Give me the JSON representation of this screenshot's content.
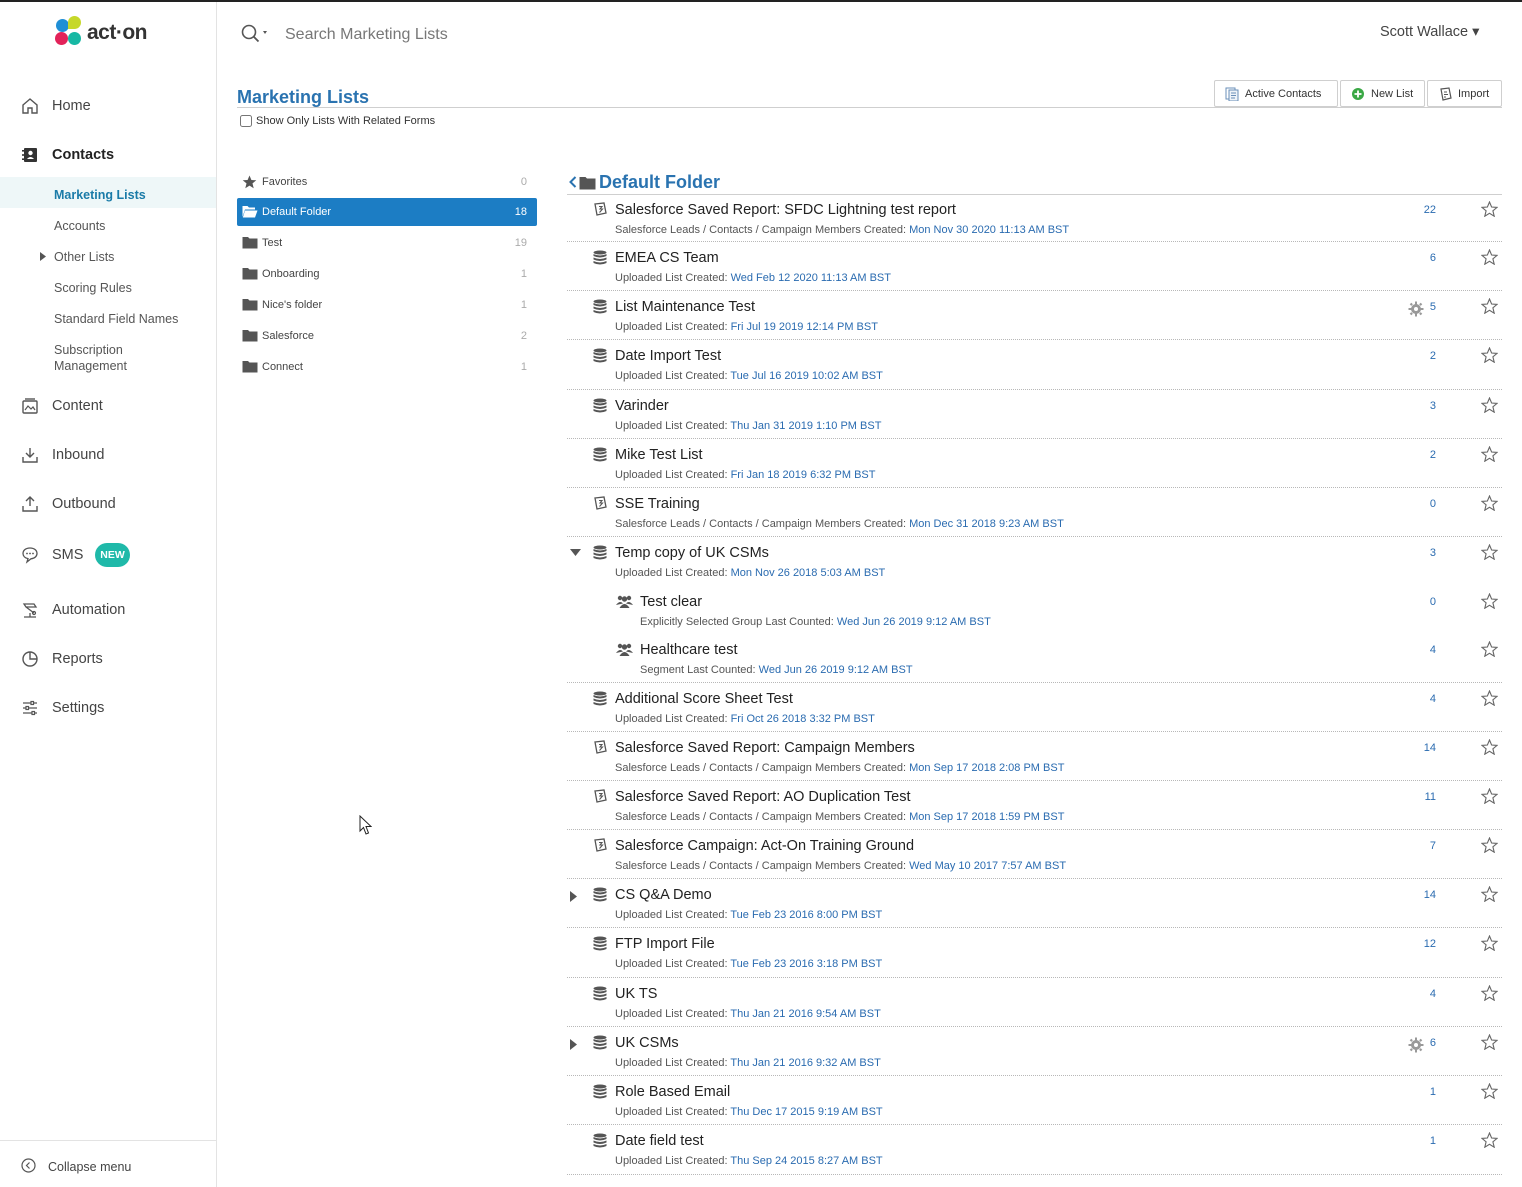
{
  "app": {
    "brand": "act·on",
    "colors": {
      "accent": "#2a73b0",
      "active_folder": "#1c7dc4",
      "badge": "#1fb9a9"
    }
  },
  "search": {
    "placeholder": "Search Marketing Lists"
  },
  "user": {
    "name": "Scott Wallace ▾"
  },
  "nav": {
    "home": "Home",
    "contacts": "Contacts",
    "content": "Content",
    "inbound": "Inbound",
    "outbound": "Outbound",
    "sms": "SMS",
    "sms_badge": "NEW",
    "automation": "Automation",
    "reports": "Reports",
    "settings": "Settings",
    "collapse": "Collapse menu"
  },
  "contacts_sub": {
    "marketing_lists": "Marketing Lists",
    "accounts": "Accounts",
    "other_lists": "Other Lists",
    "scoring_rules": "Scoring Rules",
    "standard_field_names": "Standard Field Names",
    "subscription_line1": "Subscription",
    "subscription_line2": "Management"
  },
  "header": {
    "title": "Marketing Lists",
    "related_forms_label": "Show Only Lists With Related Forms",
    "buttons": {
      "active_contacts": "Active Contacts",
      "new_list": "New List",
      "import": "Import"
    }
  },
  "folders": [
    {
      "label": "Favorites",
      "count": "0",
      "icon": "star-icon"
    },
    {
      "label": "Default Folder",
      "count": "18",
      "icon": "folder-open-icon"
    },
    {
      "label": "Test",
      "count": "19",
      "icon": "folder-icon"
    },
    {
      "label": "Onboarding",
      "count": "1",
      "icon": "folder-icon"
    },
    {
      "label": "Nice's folder",
      "count": "1",
      "icon": "folder-icon"
    },
    {
      "label": "Salesforce",
      "count": "2",
      "icon": "folder-icon"
    },
    {
      "label": "Connect",
      "count": "1",
      "icon": "folder-icon"
    }
  ],
  "current_folder": {
    "title": "Default Folder"
  },
  "lists": [
    {
      "name": "Salesforce Saved Report: SFDC Lightning test report",
      "meta": "Salesforce Leads / Contacts / Campaign Members Created: ",
      "date": "Mon Nov 30 2020 11:13 AM BST",
      "count": "22",
      "icon": "salesforce-icon"
    },
    {
      "name": "EMEA CS Team",
      "meta": "Uploaded List Created: ",
      "date": "Wed Feb 12 2020 11:13 AM BST",
      "count": "6",
      "icon": "database-icon"
    },
    {
      "name": "List Maintenance Test",
      "meta": "Uploaded List Created: ",
      "date": "Fri Jul 19 2019 12:14 PM BST",
      "count": "5",
      "icon": "database-icon"
    },
    {
      "name": "Date Import Test",
      "meta": "Uploaded List Created: ",
      "date": "Tue Jul 16 2019 10:02 AM BST",
      "count": "2",
      "icon": "database-icon"
    },
    {
      "name": "Varinder",
      "meta": "Uploaded List Created: ",
      "date": "Thu Jan 31 2019 1:10 PM BST",
      "count": "3",
      "icon": "database-icon"
    },
    {
      "name": "Mike Test List",
      "meta": "Uploaded List Created: ",
      "date": "Fri Jan 18 2019 6:32 PM BST",
      "count": "2",
      "icon": "database-icon"
    },
    {
      "name": "SSE Training",
      "meta": "Salesforce Leads / Contacts / Campaign Members Created: ",
      "date": "Mon Dec 31 2018 9:23 AM BST",
      "count": "0",
      "icon": "salesforce-icon"
    },
    {
      "name": "Temp copy of UK CSMs",
      "meta": "Uploaded List Created: ",
      "date": "Mon Nov 26 2018 5:03 AM BST",
      "count": "3",
      "icon": "database-icon"
    },
    {
      "name": "Test clear",
      "meta": "Explicitly Selected Group Last Counted: ",
      "date": "Wed Jun 26 2019 9:12 AM BST",
      "count": "0",
      "icon": "group-icon"
    },
    {
      "name": "Healthcare test",
      "meta": "Segment Last Counted: ",
      "date": "Wed Jun 26 2019 9:12 AM BST",
      "count": "4",
      "icon": "group-icon"
    },
    {
      "name": "Additional Score Sheet Test",
      "meta": "Uploaded List Created: ",
      "date": "Fri Oct 26 2018 3:32 PM BST",
      "count": "4",
      "icon": "database-icon"
    },
    {
      "name": "Salesforce Saved Report: Campaign Members",
      "meta": "Salesforce Leads / Contacts / Campaign Members Created: ",
      "date": "Mon Sep 17 2018 2:08 PM BST",
      "count": "14",
      "icon": "salesforce-icon"
    },
    {
      "name": "Salesforce Saved Report: AO Duplication Test",
      "meta": "Salesforce Leads / Contacts / Campaign Members Created: ",
      "date": "Mon Sep 17 2018 1:59 PM BST",
      "count": "11",
      "icon": "salesforce-icon"
    },
    {
      "name": "Salesforce Campaign: Act-On Training Ground",
      "meta": "Salesforce Leads / Contacts / Campaign Members Created: ",
      "date": "Wed May 10 2017 7:57 AM BST",
      "count": "7",
      "icon": "salesforce-icon"
    },
    {
      "name": "CS Q&A Demo",
      "meta": "Uploaded List Created: ",
      "date": "Tue Feb 23 2016 8:00 PM BST",
      "count": "14",
      "icon": "database-icon"
    },
    {
      "name": "FTP Import File",
      "meta": "Uploaded List Created: ",
      "date": "Tue Feb 23 2016 3:18 PM BST",
      "count": "12",
      "icon": "database-icon"
    },
    {
      "name": "UK TS",
      "meta": "Uploaded List Created: ",
      "date": "Thu Jan 21 2016 9:54 AM BST",
      "count": "4",
      "icon": "database-icon"
    },
    {
      "name": "UK CSMs",
      "meta": "Uploaded List Created: ",
      "date": "Thu Jan 21 2016 9:32 AM BST",
      "count": "6",
      "icon": "database-icon"
    },
    {
      "name": "Role Based Email",
      "meta": "Uploaded List Created: ",
      "date": "Thu Dec 17 2015 9:19 AM BST",
      "count": "1",
      "icon": "database-icon"
    },
    {
      "name": "Date field test",
      "meta": "Uploaded List Created: ",
      "date": "Thu Sep 24 2015 8:27 AM BST",
      "count": "1",
      "icon": "database-icon"
    }
  ]
}
